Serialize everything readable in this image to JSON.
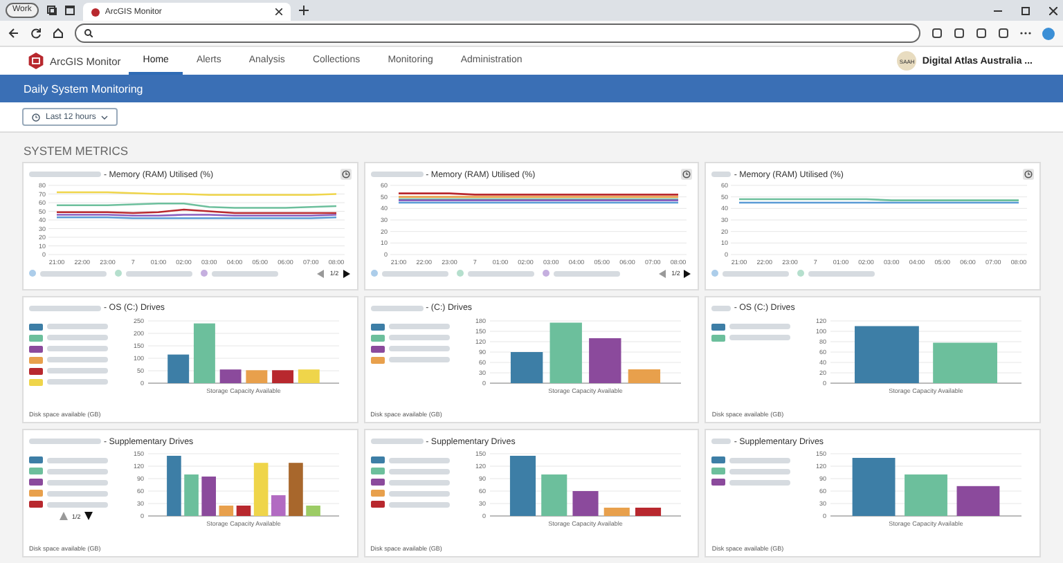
{
  "browser": {
    "profile": "Work",
    "tab_title": "ArcGIS Monitor"
  },
  "app": {
    "name": "ArcGIS Monitor",
    "user_initials": "SAAH",
    "org": "Digital Atlas Australia ...",
    "nav": [
      {
        "label": "Home",
        "selected": true
      },
      {
        "label": "Alerts",
        "selected": false
      },
      {
        "label": "Analysis",
        "selected": false
      },
      {
        "label": "Collections",
        "selected": false
      },
      {
        "label": "Monitoring",
        "selected": false
      },
      {
        "label": "Administration",
        "selected": false
      }
    ]
  },
  "banner": "Daily System Monitoring",
  "time_filter": "Last 12 hours",
  "section_title": "SYSTEM METRICS",
  "cards": [
    {
      "title": "- Memory (RAM) Utilised (%)",
      "pager": "1/2",
      "chart_data": {
        "type": "line",
        "grid": true,
        "categories": [
          "21:00",
          "22:00",
          "23:00",
          "7",
          "01:00",
          "02:00",
          "03:00",
          "04:00",
          "05:00",
          "06:00",
          "07:00",
          "08:00"
        ],
        "yticks": [
          0,
          10,
          20,
          30,
          40,
          50,
          60,
          70,
          80
        ],
        "ylim": [
          0,
          80
        ],
        "series": [
          {
            "color": "#5a9bd5",
            "values": [
              43,
              43,
              43,
              42,
              42,
              42,
              42,
              42,
              42,
              42,
              42,
              43
            ]
          },
          {
            "color": "#6cbf9c",
            "values": [
              57,
              57,
              57,
              58,
              59,
              59,
              55,
              54,
              54,
              54,
              55,
              56
            ]
          },
          {
            "color": "#8b5fbf",
            "values": [
              46,
              46,
              46,
              45,
              45,
              46,
              46,
              45,
              45,
              45,
              45,
              46
            ]
          },
          {
            "color": "#efd54a",
            "values": [
              72,
              72,
              72,
              71,
              70,
              70,
              69,
              69,
              69,
              69,
              69,
              70
            ]
          },
          {
            "color": "#b8282e",
            "values": [
              49,
              49,
              49,
              48,
              49,
              52,
              50,
              48,
              48,
              48,
              48,
              48
            ]
          }
        ]
      }
    },
    {
      "title": "- Memory (RAM) Utilised (%)",
      "pager": "1/2",
      "chart_data": {
        "type": "line",
        "grid": true,
        "categories": [
          "21:00",
          "22:00",
          "23:00",
          "7",
          "01:00",
          "02:00",
          "03:00",
          "04:00",
          "05:00",
          "06:00",
          "07:00",
          "08:00"
        ],
        "yticks": [
          0,
          10,
          20,
          30,
          40,
          50,
          60
        ],
        "ylim": [
          0,
          60
        ],
        "series": [
          {
            "color": "#5a9bd5",
            "values": [
              45,
              45,
              45,
              45,
              45,
              45,
              45,
              45,
              45,
              45,
              45,
              45
            ]
          },
          {
            "color": "#6cbf9c",
            "values": [
              48,
              48,
              48,
              48,
              48,
              48,
              48,
              48,
              48,
              48,
              48,
              48
            ]
          },
          {
            "color": "#8b5fbf",
            "values": [
              47,
              47,
              47,
              47,
              47,
              47,
              47,
              47,
              47,
              47,
              47,
              47
            ]
          },
          {
            "color": "#e8a04c",
            "values": [
              50,
              50,
              50,
              50,
              50,
              50,
              50,
              50,
              50,
              50,
              50,
              50
            ]
          },
          {
            "color": "#b8282e",
            "values": [
              53,
              53,
              53,
              52,
              52,
              52,
              52,
              52,
              52,
              52,
              52,
              52
            ]
          }
        ]
      }
    },
    {
      "title": "- Memory (RAM) Utilised (%)",
      "chart_data": {
        "type": "line",
        "grid": true,
        "categories": [
          "21:00",
          "22:00",
          "23:00",
          "7",
          "01:00",
          "02:00",
          "03:00",
          "04:00",
          "05:00",
          "06:00",
          "07:00",
          "08:00"
        ],
        "yticks": [
          0,
          10,
          20,
          30,
          40,
          50,
          60
        ],
        "ylim": [
          0,
          60
        ],
        "series": [
          {
            "color": "#5a9bd5",
            "values": [
              45,
              45,
              45,
              45,
              45,
              45,
              45,
              45,
              45,
              45,
              45,
              45
            ]
          },
          {
            "color": "#6cbf9c",
            "values": [
              48,
              48,
              48,
              48,
              48,
              48,
              47,
              47,
              47,
              47,
              47,
              47
            ]
          }
        ]
      }
    },
    {
      "title": "- OS (C:) Drives",
      "footnote": "Disk space available (GB)",
      "chart_data": {
        "type": "bar",
        "grid": true,
        "categories": [
          "Storage Capacity Available"
        ],
        "yticks": [
          0,
          50,
          100,
          150,
          200,
          250
        ],
        "ylim": [
          0,
          250
        ],
        "series": [
          {
            "color": "#3d7ea6",
            "values": [
              115
            ]
          },
          {
            "color": "#6cbf9c",
            "values": [
              240
            ]
          },
          {
            "color": "#8b4a9c",
            "values": [
              55
            ]
          },
          {
            "color": "#e8a04c",
            "values": [
              52
            ]
          },
          {
            "color": "#b8282e",
            "values": [
              52
            ]
          },
          {
            "color": "#efd54a",
            "values": [
              55
            ]
          }
        ]
      }
    },
    {
      "title": "- (C:) Drives",
      "footnote": "Disk space available (GB)",
      "chart_data": {
        "type": "bar",
        "grid": true,
        "categories": [
          "Storage Capacity Available"
        ],
        "yticks": [
          0,
          30,
          60,
          90,
          120,
          150,
          180
        ],
        "ylim": [
          0,
          180
        ],
        "series": [
          {
            "color": "#3d7ea6",
            "values": [
              90
            ]
          },
          {
            "color": "#6cbf9c",
            "values": [
              175
            ]
          },
          {
            "color": "#8b4a9c",
            "values": [
              130
            ]
          },
          {
            "color": "#e8a04c",
            "values": [
              40
            ]
          }
        ]
      }
    },
    {
      "title": "- OS (C:) Drives",
      "footnote": "Disk space available (GB)",
      "chart_data": {
        "type": "bar",
        "grid": true,
        "categories": [
          "Storage Capacity Available"
        ],
        "yticks": [
          0,
          20,
          40,
          60,
          80,
          100,
          120
        ],
        "ylim": [
          0,
          120
        ],
        "series": [
          {
            "color": "#3d7ea6",
            "values": [
              110
            ]
          },
          {
            "color": "#6cbf9c",
            "values": [
              78
            ]
          }
        ]
      }
    },
    {
      "title": "- Supplementary Drives",
      "footnote": "Disk space available (GB)",
      "pager": "1/2",
      "chart_data": {
        "type": "bar",
        "grid": true,
        "categories": [
          "Storage Capacity Available"
        ],
        "yticks": [
          0,
          30,
          60,
          90,
          120,
          150
        ],
        "ylim": [
          0,
          150
        ],
        "series": [
          {
            "color": "#3d7ea6",
            "values": [
              145
            ]
          },
          {
            "color": "#6cbf9c",
            "values": [
              100
            ]
          },
          {
            "color": "#8b4a9c",
            "values": [
              95
            ]
          },
          {
            "color": "#e8a04c",
            "values": [
              25
            ]
          },
          {
            "color": "#b8282e",
            "values": [
              25
            ]
          },
          {
            "color": "#efd54a",
            "values": [
              128
            ]
          },
          {
            "color": "#b26bc2",
            "values": [
              50
            ]
          },
          {
            "color": "#a8672c",
            "values": [
              128
            ]
          },
          {
            "color": "#9ccc65",
            "values": [
              25
            ]
          }
        ]
      }
    },
    {
      "title": "- Supplementary Drives",
      "footnote": "Disk space available (GB)",
      "chart_data": {
        "type": "bar",
        "grid": true,
        "categories": [
          "Storage Capacity Available"
        ],
        "yticks": [
          0,
          30,
          60,
          90,
          120,
          150
        ],
        "ylim": [
          0,
          150
        ],
        "series": [
          {
            "color": "#3d7ea6",
            "values": [
              145
            ]
          },
          {
            "color": "#6cbf9c",
            "values": [
              100
            ]
          },
          {
            "color": "#8b4a9c",
            "values": [
              60
            ]
          },
          {
            "color": "#e8a04c",
            "values": [
              20
            ]
          },
          {
            "color": "#b8282e",
            "values": [
              20
            ]
          }
        ]
      }
    },
    {
      "title": "- Supplementary Drives",
      "footnote": "Disk space available (GB)",
      "chart_data": {
        "type": "bar",
        "grid": true,
        "categories": [
          "Storage Capacity Available"
        ],
        "yticks": [
          0,
          30,
          60,
          90,
          120,
          150
        ],
        "ylim": [
          0,
          150
        ],
        "series": [
          {
            "color": "#3d7ea6",
            "values": [
              140
            ]
          },
          {
            "color": "#6cbf9c",
            "values": [
              100
            ]
          },
          {
            "color": "#8b4a9c",
            "values": [
              72
            ]
          }
        ]
      }
    }
  ]
}
